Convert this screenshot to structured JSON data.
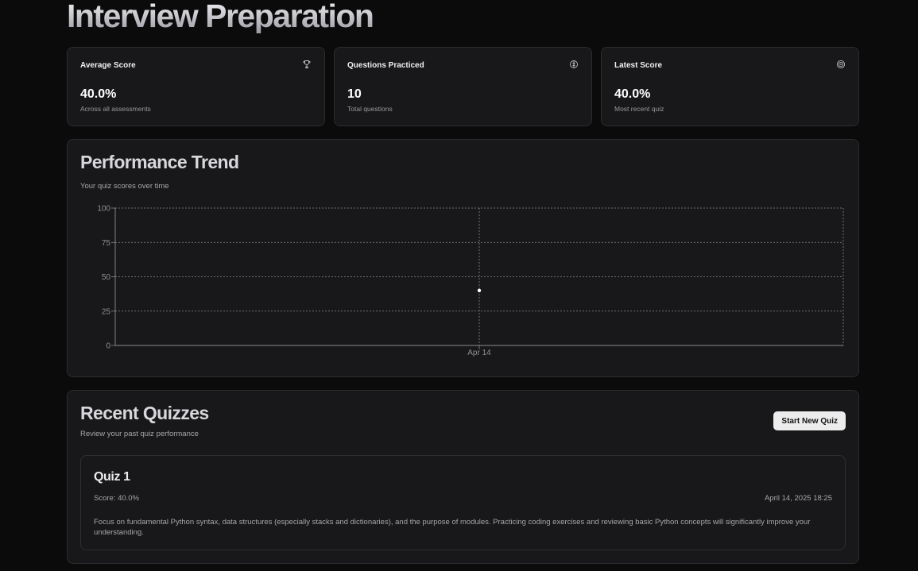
{
  "page": {
    "title": "Interview Preparation"
  },
  "stats": [
    {
      "title": "Average Score",
      "value": "40.0%",
      "subtitle": "Across all assessments",
      "icon": "trophy-icon"
    },
    {
      "title": "Questions Practiced",
      "value": "10",
      "subtitle": "Total questions",
      "icon": "brain-icon"
    },
    {
      "title": "Latest Score",
      "value": "40.0%",
      "subtitle": "Most recent quiz",
      "icon": "target-icon"
    }
  ],
  "performance": {
    "title": "Performance Trend",
    "subtitle": "Your quiz scores over time"
  },
  "chart_data": {
    "type": "line",
    "title": "",
    "xlabel": "",
    "ylabel": "",
    "categories": [
      "Apr 14"
    ],
    "series": [
      {
        "values": [
          40
        ]
      }
    ],
    "ylim": [
      0,
      100
    ],
    "yticks": [
      0,
      25,
      50,
      75,
      100
    ],
    "grid": true,
    "grid_style": "dashed",
    "point_color": "#ffffff"
  },
  "recent": {
    "title": "Recent Quizzes",
    "subtitle": "Review your past quiz performance",
    "start_button": "Start New Quiz",
    "quizzes": [
      {
        "title": "Quiz 1",
        "score": "Score: 40.0%",
        "date": "April 14, 2025 18:25",
        "feedback": "Focus on fundamental Python syntax, data structures (especially stacks and dictionaries), and the purpose of modules. Practicing coding exercises and reviewing basic Python concepts will significantly improve your understanding."
      }
    ]
  },
  "colors": {
    "background": "#0b0b0c",
    "card": "#18181a",
    "border": "#2c2c2f",
    "button_bg": "#ececec"
  }
}
